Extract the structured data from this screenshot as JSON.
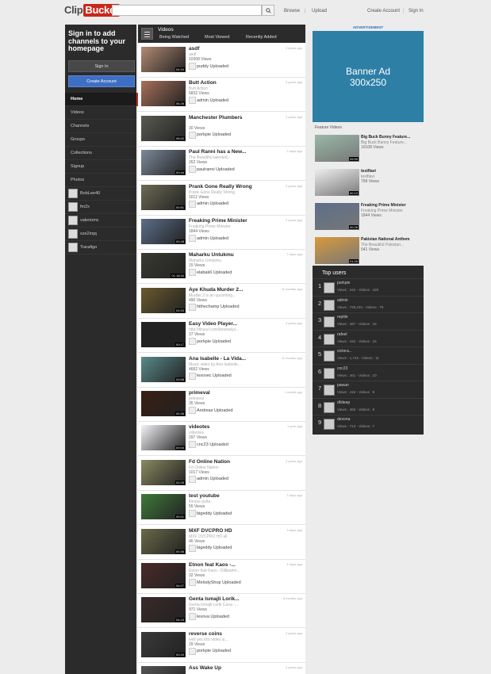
{
  "header": {
    "logo_part1": "Clip",
    "logo_part2": "Bucket",
    "search_placeholder": "",
    "browse": "Browse",
    "upload": "Upload",
    "create_account": "Create Account",
    "sign_in": "Sign In"
  },
  "left": {
    "signin_title": "Sign in to add channels to your homepage",
    "signin_button": "Sign In",
    "create_button": "Create Account",
    "nav": [
      "Home",
      "Videos",
      "Channels",
      "Groups",
      "Collections",
      "Signup",
      "Photos"
    ],
    "channels": [
      "BobLee40",
      "fm2x",
      "valeriomc",
      "xze2irqq",
      "Tiarafigo"
    ]
  },
  "center": {
    "section_title": "Videos",
    "tabs": [
      "Being Watched",
      "Most Viewed",
      "Recently Added"
    ],
    "videos": [
      {
        "title": "asdf",
        "desc": "asdf",
        "views": "10308 Views",
        "user": "puddy Uploaded",
        "time": "2 years ago",
        "duration": "04:34",
        "thumb": "#b38a74"
      },
      {
        "title": "Butt Action",
        "desc": "Butt Action",
        "views": "6832 Views",
        "user": "admin Uploaded",
        "time": "2 years ago",
        "duration": "06:26",
        "thumb": "#a8705a"
      },
      {
        "title": "Manchester Plumbers",
        "desc": "",
        "views": "30 Views",
        "user": "porkpie Uploaded",
        "time": "2 years ago",
        "duration": "06:02",
        "thumb": "#5a5a52"
      },
      {
        "title": "Paul Ranni has a New...",
        "desc": "The Beautiful talented...",
        "views": "262 Views",
        "user": "paulranni Uploaded",
        "time": "2 days ago",
        "duration": "00:44",
        "thumb": "#7c8a9c"
      },
      {
        "title": "Prank Gone Really Wrong",
        "desc": "Prank Gone Really Wrong",
        "views": "1611 Views",
        "user": "admin Uploaded",
        "time": "2 years ago",
        "duration": "00:51",
        "thumb": "#6b6a54"
      },
      {
        "title": "Freaking Prime Minister",
        "desc": "Freaking Prime Minister",
        "views": "1844 Views",
        "user": "admin Uploaded",
        "time": "2 years ago",
        "duration": "00:28",
        "thumb": "#5c6e8a"
      },
      {
        "title": "Maharku Untukmu",
        "desc": "Maharku Untukmu",
        "views": "15 Views",
        "user": "elabak6 Uploaded",
        "time": "7 days ago",
        "duration": "01:18:34",
        "thumb": "#3a3a32"
      },
      {
        "title": "Aye Khuda Murder 2...",
        "desc": "Murder 2 is an upcoming...",
        "views": "490 Views",
        "user": "hithechamp Uploaded",
        "time": "11 months ago",
        "duration": "04:53",
        "thumb": "#6a5a2e"
      },
      {
        "title": "Easy Video Player...",
        "desc": "http://tinyurl.com/beveasyv...",
        "views": "37 Views",
        "user": "porkpie Uploaded",
        "time": "2 years ago",
        "duration": "00:17",
        "thumb": "#222222"
      },
      {
        "title": "Ana Isabelle - La Vida...",
        "desc": "Music video by Ana Isabelle...",
        "views": "4662 Views",
        "user": "lexovec Uploaded",
        "time": "11 months ago",
        "duration": "03:58",
        "thumb": "#5a8a8a"
      },
      {
        "title": "primeval",
        "desc": "primeval",
        "views": "35 Views",
        "user": "Andreas Uploaded",
        "time": "1 month ago",
        "duration": "00:36",
        "thumb": "#3a1e12"
      },
      {
        "title": "videotes",
        "desc": "videotes",
        "views": "297 Views",
        "user": "cnc23 Uploaded",
        "time": "1 year ago",
        "duration": "00:04",
        "thumb": "#f4f4f8"
      },
      {
        "title": "Fd Online Nation",
        "desc": "Fd Online Nation",
        "views": "1017 Views",
        "user": "admin Uploaded",
        "time": "2 years ago",
        "duration": "00:25",
        "thumb": "#8a8a62"
      },
      {
        "title": "test youtube",
        "desc": "filmure polta",
        "views": "55 Views",
        "user": "bigeddy Uploaded",
        "time": "3 days ago",
        "duration": "00:01",
        "thumb": "#3e7a3a"
      },
      {
        "title": "MXF DVCPRO HD",
        "desc": "MXF DVCPRO HD all",
        "views": "46 Views",
        "user": "bigeddy Uploaded",
        "time": "3 days ago",
        "duration": "00:36",
        "thumb": "#6a6a4a"
      },
      {
        "title": "Etnon feat Kaos -...",
        "desc": "Etnon feat Kaos - Dilliparim...",
        "views": "32 Views",
        "user": "MelodyShop Uploaded",
        "time": "4 days ago",
        "duration": "04:07",
        "thumb": "#4a2a2a"
      },
      {
        "title": "Genta Ismajli Lorik...",
        "desc": "Genta Ismajli Lorik Cana -...",
        "views": "971 Views",
        "user": "lexova Uploaded",
        "time": "8 months ago",
        "duration": "04:16",
        "thumb": "#3a2a2a"
      },
      {
        "title": "reverse coins",
        "desc": "well yes this video is...",
        "views": "29 Views",
        "user": "porkpie Uploaded",
        "time": "2 years ago",
        "duration": "00:20",
        "thumb": "#3a3a3a"
      },
      {
        "title": "Ass Wake Up",
        "desc": "",
        "views": "",
        "user": "",
        "time": "2 years ago",
        "duration": "",
        "thumb": "#555555"
      }
    ]
  },
  "right": {
    "ad_label": "ADVERTISEMENT",
    "banner_line1": "Banner Ad",
    "banner_line2": "300x250",
    "featured_label": "Feature Videos",
    "featured": [
      {
        "title": "Big Buck Bunny Feature...",
        "desc": "Big Buck Bunny Feature...",
        "views": "10108 Views",
        "duration": "09:59",
        "thumb": "#9ab8a8"
      },
      {
        "title": "testflavi",
        "desc": "testflavi",
        "views": "799 Views",
        "duration": "00:10",
        "thumb": "#eeeeee"
      },
      {
        "title": "Freaking Prime Minister",
        "desc": "Freaking Prime Minister",
        "views": "1844 Views",
        "duration": "00:28",
        "thumb": "#5c6e8a"
      },
      {
        "title": "Pakistan National Anthem",
        "desc": "The Beautiful Pakistan...",
        "views": "541 Views",
        "duration": "01:05",
        "thumb": "#d89a3a"
      }
    ],
    "top_users_title": "Top users",
    "top_users": [
      {
        "rank": "1",
        "name": "porkpie",
        "stats": "Views : 242 - Videos : 429"
      },
      {
        "rank": "2",
        "name": "admin",
        "stats": "Views : 729,103 - Videos : 79"
      },
      {
        "rank": "3",
        "name": "reptile",
        "stats": "Views : 487 - Videos : 16"
      },
      {
        "rank": "4",
        "name": "rafeel",
        "stats": "Views : 432 - Videos : 15"
      },
      {
        "rank": "5",
        "name": "victora...",
        "stats": "Views : 1,743 - Videos : 11"
      },
      {
        "rank": "6",
        "name": "cnc23",
        "stats": "Views : 401 - Videos : 10"
      },
      {
        "rank": "7",
        "name": "pawan",
        "stats": "Views : 418 - Videos : 9"
      },
      {
        "rank": "8",
        "name": "dhileep",
        "stats": "Views : 465 - Videos : 8"
      },
      {
        "rank": "9",
        "name": "devona",
        "stats": "Views : 713 - Videos : 7"
      }
    ]
  }
}
